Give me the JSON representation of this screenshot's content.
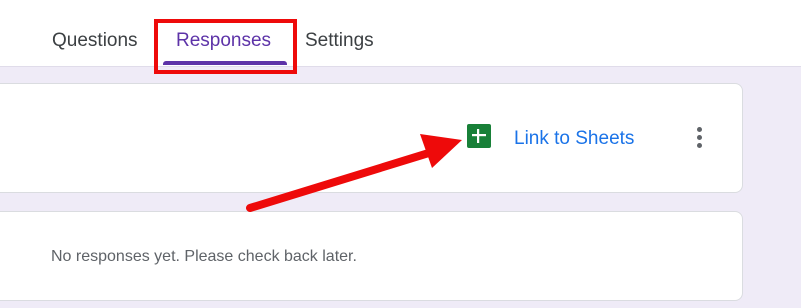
{
  "tabs": {
    "questions": "Questions",
    "responses": "Responses",
    "settings": "Settings"
  },
  "sheets": {
    "link_label": "Link to Sheets",
    "icon": "google-sheets-icon"
  },
  "menu": {
    "icon": "more-vert-icon"
  },
  "responses": {
    "empty_message": "No responses yet. Please check back later."
  },
  "colors": {
    "accent": "#5d33a8",
    "link": "#1a73e8",
    "annotation": "#ee0a0a",
    "sheets_green": "#188038",
    "background": "#efebf7"
  }
}
